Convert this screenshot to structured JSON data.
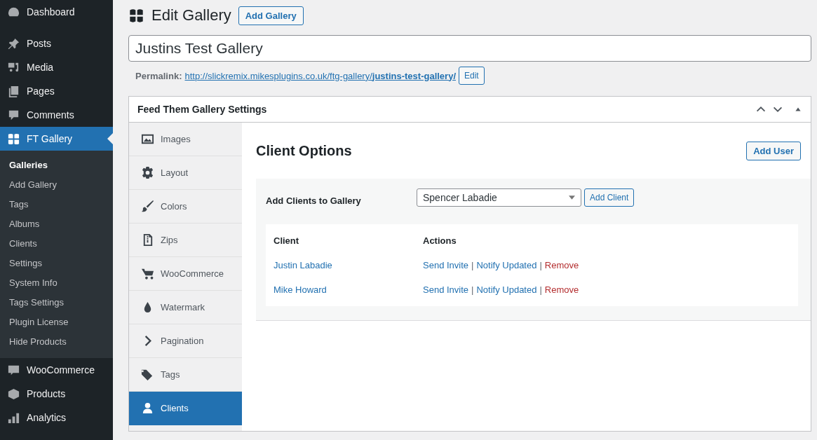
{
  "sidebar": {
    "top_items": [
      {
        "label": "Dashboard",
        "selected": false
      },
      {
        "label": "Posts",
        "selected": false
      },
      {
        "label": "Media",
        "selected": false
      },
      {
        "label": "Pages",
        "selected": false
      },
      {
        "label": "Comments",
        "selected": false
      },
      {
        "label": "FT Gallery",
        "selected": true
      }
    ],
    "submenu": [
      {
        "label": "Galleries",
        "selected": true
      },
      {
        "label": "Add Gallery",
        "selected": false
      },
      {
        "label": "Tags",
        "selected": false
      },
      {
        "label": "Albums",
        "selected": false
      },
      {
        "label": "Clients",
        "selected": false
      },
      {
        "label": "Settings",
        "selected": false
      },
      {
        "label": "System Info",
        "selected": false
      },
      {
        "label": "Tags Settings",
        "selected": false
      },
      {
        "label": "Plugin License",
        "selected": false
      },
      {
        "label": "Hide Products",
        "selected": false
      }
    ],
    "bottom_items": [
      {
        "label": "WooCommerce",
        "selected": false
      },
      {
        "label": "Products",
        "selected": false
      },
      {
        "label": "Analytics",
        "selected": false
      }
    ]
  },
  "header": {
    "title": "Edit Gallery",
    "button": "Add Gallery"
  },
  "title_field": {
    "value": "Justins Test Gallery"
  },
  "permalink": {
    "label": "Permalink:",
    "url": "http://slickremix.mikesplugins.co.uk/ftg-gallery/**justins-test-gallery/**",
    "button": "Edit"
  },
  "settings_box": {
    "title": "Feed Them Gallery Settings",
    "tabs": [
      {
        "label": "Images",
        "selected": false
      },
      {
        "label": "Layout",
        "selected": false
      },
      {
        "label": "Colors",
        "selected": false
      },
      {
        "label": "Zips",
        "selected": false
      },
      {
        "label": "WooCommerce",
        "selected": false
      },
      {
        "label": "Watermark",
        "selected": false
      },
      {
        "label": "Pagination",
        "selected": false
      },
      {
        "label": "Tags",
        "selected": false
      },
      {
        "label": "Clients",
        "selected": true
      }
    ],
    "panel": {
      "title": "Client Options",
      "add_user_button": "Add User",
      "add_clients_label": "Add Clients to Gallery",
      "select_value": "Spencer Labadie",
      "add_client_button": "Add Client",
      "columns": [
        "Client",
        "Actions"
      ],
      "rows": [
        {
          "client": "Justin Labadie",
          "actions": [
            "Send Invite",
            "Notify Updated",
            "Remove"
          ]
        },
        {
          "client": "Mike Howard",
          "actions": [
            "Send Invite",
            "Notify Updated",
            "Remove"
          ]
        }
      ],
      "separator": "|"
    }
  }
}
